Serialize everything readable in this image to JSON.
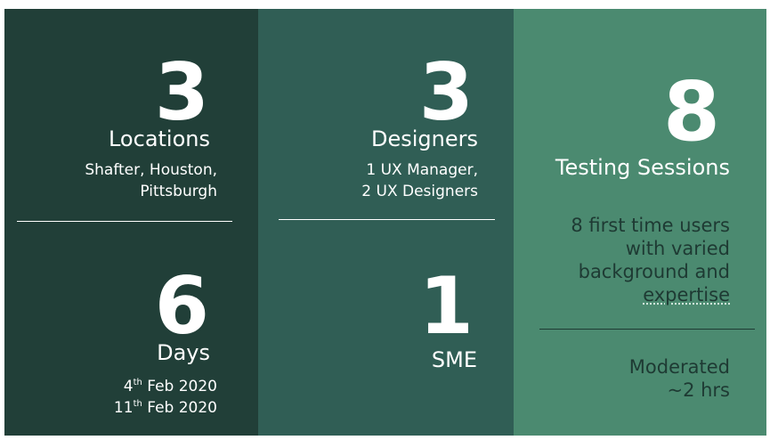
{
  "locations": {
    "count": "3",
    "label": "Locations",
    "detail_line1": "Shafter, Houston,",
    "detail_line2": "Pittsburgh"
  },
  "days": {
    "count": "6",
    "label": "Days",
    "start_day": "4",
    "start_suffix": "th",
    "start_rest": " Feb 2020",
    "end_day": "11",
    "end_suffix": "th",
    "end_rest": " Feb 2020"
  },
  "designers": {
    "count": "3",
    "label": "Designers",
    "detail_line1": "1 UX Manager,",
    "detail_line2": "2 UX Designers"
  },
  "sme": {
    "count": "1",
    "label": "SME"
  },
  "testing": {
    "count": "8",
    "label": "Testing Sessions",
    "users_line1": "8 first time users",
    "users_line2": "with varied",
    "users_line3": "background and",
    "users_line4": "expertise",
    "mode_line1": "Moderated",
    "mode_line2": "~2 hrs"
  },
  "colors": {
    "panel1": "#213f38",
    "panel2": "#305e55",
    "panel3": "#4b8a70"
  }
}
